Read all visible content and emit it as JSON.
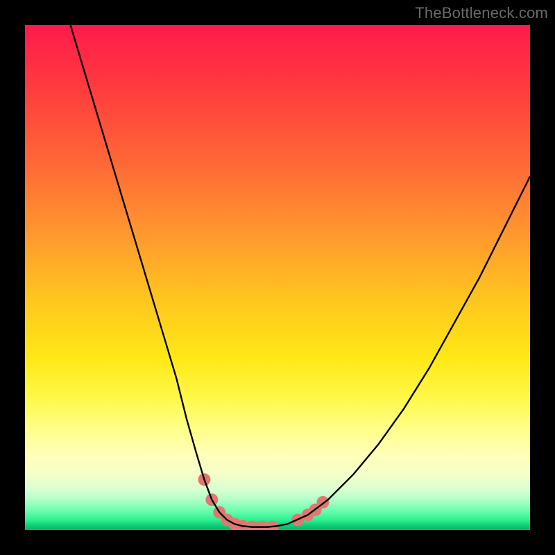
{
  "watermark": "TheBottleneck.com",
  "chart_data": {
    "type": "line",
    "title": "",
    "xlabel": "",
    "ylabel": "",
    "xlim": [
      0,
      100
    ],
    "ylim": [
      0,
      100
    ],
    "series": [
      {
        "name": "curve",
        "color": "#000000",
        "x": [
          9,
          12,
          15,
          18,
          21,
          24,
          27,
          30,
          32,
          34,
          35.5,
          37,
          38.5,
          40,
          41.5,
          43,
          45,
          48,
          50,
          52,
          56,
          60,
          65,
          70,
          75,
          80,
          85,
          90,
          95,
          98,
          100
        ],
        "values": [
          100,
          90,
          80,
          70,
          60,
          50,
          40,
          30,
          22,
          15,
          10,
          6,
          3.5,
          2,
          1.2,
          0.8,
          0.6,
          0.6,
          0.8,
          1.2,
          3,
          6,
          11,
          17,
          24,
          32,
          41,
          50,
          60,
          66,
          70
        ]
      }
    ],
    "markers": {
      "name": "low-band-markers",
      "color": "#e07870",
      "r": 9,
      "points": [
        {
          "x": 35.5,
          "y": 10
        },
        {
          "x": 37,
          "y": 6
        },
        {
          "x": 38.5,
          "y": 3.5
        },
        {
          "x": 40,
          "y": 2
        },
        {
          "x": 41.5,
          "y": 1.2
        },
        {
          "x": 43,
          "y": 0.8
        },
        {
          "x": 45,
          "y": 0.6
        },
        {
          "x": 47,
          "y": 0.6
        },
        {
          "x": 49,
          "y": 0.6
        },
        {
          "x": 54,
          "y": 2
        },
        {
          "x": 56,
          "y": 3
        },
        {
          "x": 57.5,
          "y": 4
        },
        {
          "x": 59,
          "y": 5.5
        }
      ]
    }
  }
}
